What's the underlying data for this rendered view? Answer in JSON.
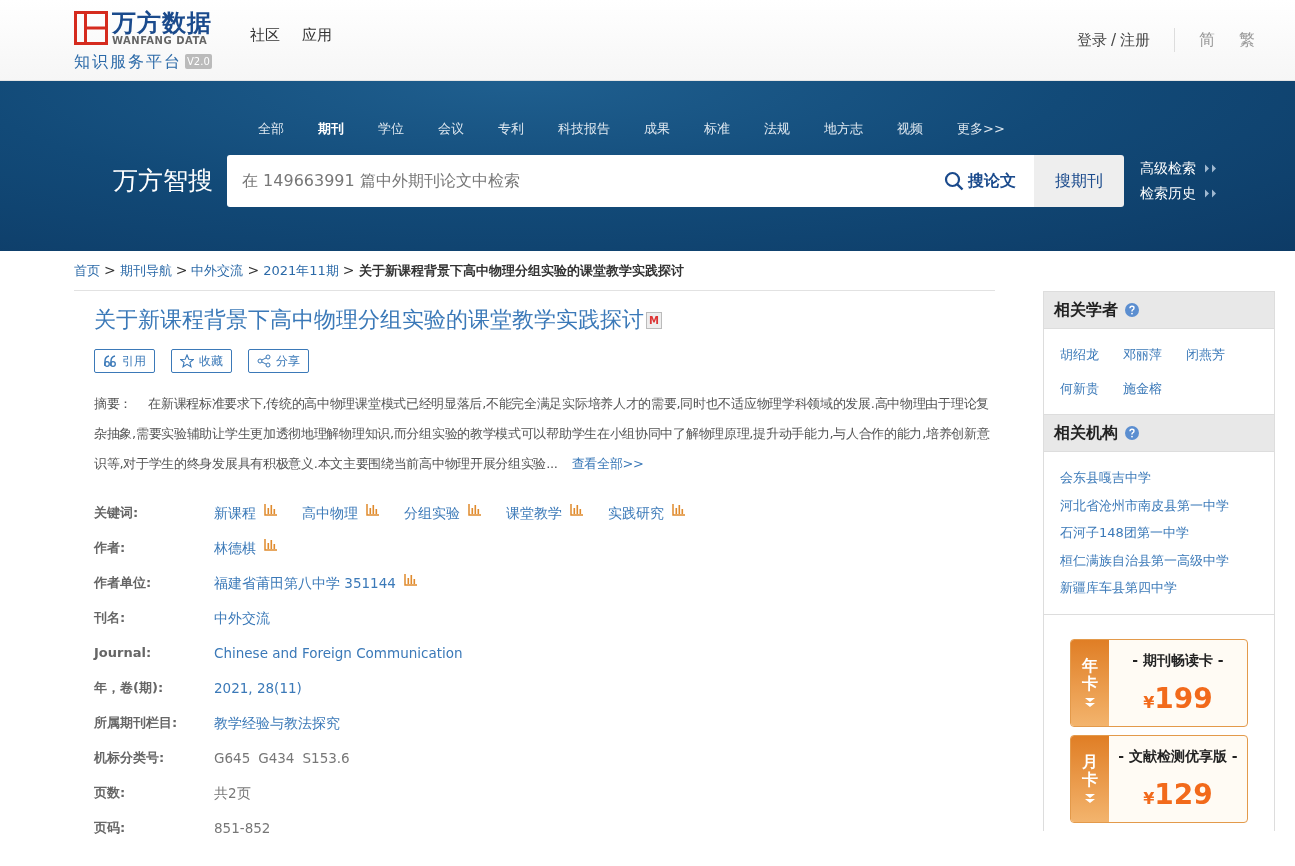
{
  "header": {
    "logo": {
      "brand": "万方数据",
      "brand_en": "WANFANG DATA",
      "platform": "知识服务平台",
      "version": "V2.0"
    },
    "nav": [
      "社区",
      "应用"
    ],
    "login": "登录",
    "separator": "/",
    "register": "注册",
    "languages": [
      "简",
      "繁"
    ]
  },
  "search": {
    "tabs": [
      {
        "label": "全部",
        "selected": false
      },
      {
        "label": "期刊",
        "selected": true
      },
      {
        "label": "学位",
        "selected": false
      },
      {
        "label": "会议",
        "selected": false
      },
      {
        "label": "专利",
        "selected": false
      },
      {
        "label": "科技报告",
        "selected": false
      },
      {
        "label": "成果",
        "selected": false
      },
      {
        "label": "标准",
        "selected": false
      },
      {
        "label": "法规",
        "selected": false
      },
      {
        "label": "地方志",
        "selected": false
      },
      {
        "label": "视频",
        "selected": false
      },
      {
        "label": "更多>>",
        "selected": false
      }
    ],
    "brand": "万方智搜",
    "placeholder": "在 149663991 篇中外期刊论文中检索",
    "primary_button": "搜论文",
    "secondary_button": "搜期刊",
    "links": [
      "高级检索",
      "检索历史"
    ]
  },
  "breadcrumb_separator": ">",
  "breadcrumb": [
    {
      "label": "首页",
      "current": false
    },
    {
      "label": "期刊导航",
      "current": false
    },
    {
      "label": "中外交流",
      "current": false
    },
    {
      "label": "2021年11期",
      "current": false
    },
    {
      "label": "关于新课程背景下高中物理分组实验的课堂教学实践探讨",
      "current": true
    }
  ],
  "article": {
    "title": "关于新课程背景下高中物理分组实验的课堂教学实践探讨",
    "title_badge": "M",
    "actions": [
      {
        "label": "引用",
        "kind": "cite"
      },
      {
        "label": "收藏",
        "kind": "favorite"
      },
      {
        "label": "分享",
        "kind": "share"
      }
    ],
    "abstract": {
      "label": "摘要：",
      "text": "在新课程标准要求下,传统的高中物理课堂模式已经明显落后,不能完全满足实际培养人才的需要,同时也不适应物理学科领域的发展.高中物理由于理论复杂抽象,需要实验辅助让学生更加透彻地理解物理知识,而分组实验的教学模式可以帮助学生在小组协同中了解物理原理,提升动手能力,与人合作的能力,培养创新意识等,对于学生的终身发展具有积极意义.本文主要围绕当前高中物理开展分组实验...",
      "more": "查看全部>>"
    },
    "fields": [
      {
        "label": "关键词:",
        "kind": "link",
        "stats": true,
        "values": [
          "新课程",
          "高中物理",
          "分组实验",
          "课堂教学",
          "实践研究"
        ]
      },
      {
        "label": "作者:",
        "kind": "link",
        "stats": true,
        "values": [
          "林德棋"
        ]
      },
      {
        "label": "作者单位:",
        "kind": "link",
        "stats": true,
        "values": [
          "福建省莆田第八中学 351144"
        ]
      },
      {
        "label": "刊名:",
        "kind": "link",
        "stats": false,
        "values": [
          "中外交流"
        ]
      },
      {
        "label": "Journal:",
        "kind": "link",
        "stats": false,
        "values": [
          "Chinese and Foreign Communication"
        ]
      },
      {
        "label": "年，卷(期):",
        "kind": "link",
        "stats": false,
        "values": [
          "2021, 28(11)"
        ]
      },
      {
        "label": "所属期刊栏目:",
        "kind": "link",
        "stats": false,
        "values": [
          "教学经验与教法探究"
        ]
      },
      {
        "label": "机标分类号:",
        "kind": "plain",
        "stats": false,
        "values": [
          "G645",
          "G434",
          "S153.6"
        ]
      },
      {
        "label": "页数:",
        "kind": "plain",
        "stats": false,
        "values": [
          "共2页"
        ]
      },
      {
        "label": "页码:",
        "kind": "plain",
        "stats": false,
        "values": [
          "851-852"
        ]
      }
    ]
  },
  "sidebar": {
    "panels": [
      {
        "title": "相关学者",
        "kind": "inline",
        "items": [
          "胡绍龙",
          "邓丽萍",
          "闭燕芳",
          "何新贵",
          "施金榕"
        ]
      },
      {
        "title": "相关机构",
        "kind": "stacked",
        "items": [
          "会东县嘎吉中学",
          "河北省沧州市南皮县第一中学",
          "石河子148团第一中学",
          "桓仁满族自治县第一高级中学",
          "新疆库车县第四中学"
        ]
      }
    ],
    "cards": [
      {
        "tag": "年卡",
        "title": "- 期刊畅读卡 -",
        "currency": "¥",
        "amount": "199"
      },
      {
        "tag": "月卡",
        "title": "- 文献检测优享版 -",
        "currency": "¥",
        "amount": "129"
      }
    ]
  }
}
